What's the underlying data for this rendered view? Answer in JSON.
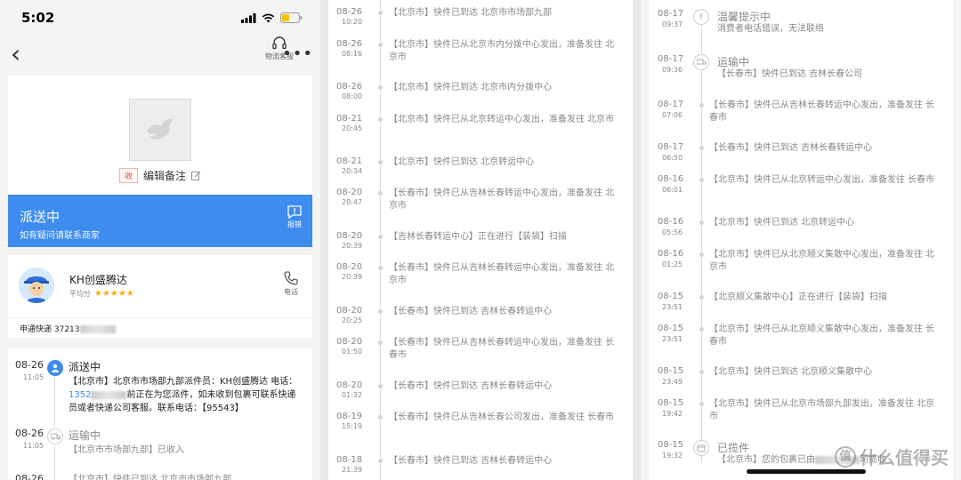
{
  "status_bar": {
    "time": "5:02"
  },
  "nav": {
    "back": "‹",
    "service_label": "物流客服",
    "more": "•••"
  },
  "shop": {
    "tag": "收",
    "edit_note": "编辑备注"
  },
  "delivery_status": {
    "title": "派送中",
    "subtitle": "如有疑问请联系商家",
    "report_label": "报错"
  },
  "courier": {
    "name": "KH创盛腾达",
    "rating_label": "平均分",
    "stars": 5,
    "stars_text": "★★★★★",
    "phone_label": "电话",
    "tracking_prefix": "申通快递 37213"
  },
  "timeline_main": [
    {
      "date": "08-26",
      "time": "11:05",
      "title": "派送中",
      "body_1": "【北京市】北京市市场部九部派件员：KH创盛腾达 电话：",
      "phone": "1352",
      "body_2": "前正在为您派件，如未收到包裹可联系快递员或者快递公司客服。联系电话：【95543】"
    },
    {
      "date": "08-26",
      "time": "11:05",
      "title": "运输中",
      "body": "【北京市市场部九部】已收入"
    },
    {
      "date": "08-26",
      "time": "",
      "title": "",
      "body": "【北京市】快件已到达 北京市市场部九部"
    }
  ],
  "timeline_middle": [
    {
      "date": "08-26",
      "time": "10:20",
      "text": "【北京市】快件已到达 北京市市场部九部"
    },
    {
      "date": "08-26",
      "time": "08:16",
      "text": "【北京市】快件已从北京市内分拨中心发出，准备发往 北京市"
    },
    {
      "date": "08-26",
      "time": "08:00",
      "text": "【北京市】快件已到达 北京市内分拨中心"
    },
    {
      "date": "08-21",
      "time": "20:45",
      "text": "【北京市】快件已从北京转运中心发出，准备发往 北京市"
    },
    {
      "date": "08-21",
      "time": "20:34",
      "text": "【北京市】快件已到达 北京转运中心"
    },
    {
      "date": "08-20",
      "time": "20:47",
      "text": "【长春市】快件已从吉林长春转运中心发出，准备发往 北京市"
    },
    {
      "date": "08-20",
      "time": "20:39",
      "text": "【吉林长春转运中心】正在进行【装袋】扫描"
    },
    {
      "date": "08-20",
      "time": "20:39",
      "text": "【长春市】快件已从吉林长春转运中心发出，准备发往 北京市"
    },
    {
      "date": "08-20",
      "time": "20:25",
      "text": "【长春市】快件已到达 吉林长春转运中心"
    },
    {
      "date": "08-20",
      "time": "01:50",
      "text": "【长春市】快件已从吉林长春转运中心发出，准备发往 长春市"
    },
    {
      "date": "08-20",
      "time": "01:32",
      "text": "【长春市】快件已到达 吉林长春转运中心"
    },
    {
      "date": "08-19",
      "time": "15:19",
      "text": "【长春市】快件已从吉林长春公司发出，准备发往 长春市"
    },
    {
      "date": "08-18",
      "time": "21:39",
      "text": "【长春市】快件已到达 吉林长春转运中心"
    }
  ],
  "timeline_right": [
    {
      "date": "08-17",
      "time": "09:37",
      "title": "温馨提示中",
      "text": "消费者电话错误，无法联络",
      "icon": "!"
    },
    {
      "date": "08-17",
      "time": "09:36",
      "title": "运输中",
      "text": "【长春市】快件已到达 吉林长春公司",
      "icon": "truck"
    },
    {
      "date": "08-17",
      "time": "07:06",
      "text": "【长春市】快件已从吉林长春转运中心发出，准备发往 长春市"
    },
    {
      "date": "08-17",
      "time": "06:50",
      "text": "【长春市】快件已到达 吉林长春转运中心"
    },
    {
      "date": "08-16",
      "time": "06:01",
      "text": "【北京市】快件已从北京转运中心发出，准备发往 长春市"
    },
    {
      "date": "08-16",
      "time": "05:56",
      "text": "【北京市】快件已到达 北京转运中心"
    },
    {
      "date": "08-16",
      "time": "01:25",
      "text": "【北京市】快件已从北京顺义集散中心发出，准备发往 北京市"
    },
    {
      "date": "08-15",
      "time": "23:51",
      "text": "【北京顺义集散中心】正在进行【装袋】扫描"
    },
    {
      "date": "08-15",
      "time": "23:51",
      "text": "【北京市】快件已从北京顺义集散中心发出，准备发往 长春市"
    },
    {
      "date": "08-15",
      "time": "23:49",
      "text": "【北京市】快件已到达 北京顺义集散中心"
    },
    {
      "date": "08-15",
      "time": "19:42",
      "text": "【北京市】快件已从北京市场部九部发出，准备发往 北京市"
    },
    {
      "date": "08-15",
      "time": "19:32",
      "title": "已揽件",
      "text": "【北京市】您的包裹已由",
      "text_tail": "司揽收",
      "icon": "box"
    }
  ],
  "watermark": {
    "symbol": "值",
    "text": "什么值得买"
  }
}
